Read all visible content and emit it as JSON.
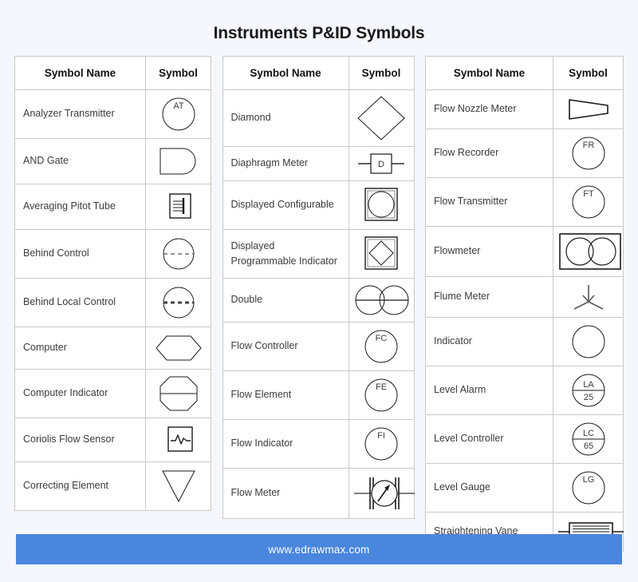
{
  "title": "Instruments P&ID Symbols",
  "colors": {
    "page_background": "#f5f7fd",
    "table_background": "#ffffff",
    "border": "#c9c9c9",
    "stroke": "#1a1a1a",
    "footer_background": "#4a86dd",
    "footer_text": "#ffffff"
  },
  "headers": {
    "name": "Symbol Name",
    "symbol": "Symbol"
  },
  "tables": [
    {
      "id": "table-1",
      "rows": [
        {
          "name": "Analyzer Transmitter",
          "symbol": "circle-labeled",
          "label": "AT"
        },
        {
          "name": "AND Gate",
          "symbol": "and-gate"
        },
        {
          "name": "Averaging Pitot Tube",
          "symbol": "pitot-tube"
        },
        {
          "name": "Behind Control",
          "symbol": "circle-dashed-thin"
        },
        {
          "name": "Behind Local Control",
          "symbol": "circle-dashed-thick"
        },
        {
          "name": "Computer",
          "symbol": "hexagon"
        },
        {
          "name": "Computer Indicator",
          "symbol": "octagon-divided"
        },
        {
          "name": "Coriolis Flow Sensor",
          "symbol": "coriolis-wave-box"
        },
        {
          "name": "Correcting Element",
          "symbol": "triangle-down"
        }
      ]
    },
    {
      "id": "table-2",
      "rows": [
        {
          "name": "Diamond",
          "symbol": "diamond"
        },
        {
          "name": "Diaphragm Meter",
          "symbol": "inline-box-labeled",
          "label": "D"
        },
        {
          "name": "Displayed Configurable",
          "symbol": "double-square-circle"
        },
        {
          "name": "Displayed Programmable Indicator",
          "symbol": "double-square-diamond"
        },
        {
          "name": "Double",
          "symbol": "double-circle"
        },
        {
          "name": "Flow Controller",
          "symbol": "circle-labeled",
          "label": "FC"
        },
        {
          "name": "Flow Element",
          "symbol": "circle-labeled",
          "label": "FE"
        },
        {
          "name": "Flow Indicator",
          "symbol": "circle-labeled",
          "label": "FI"
        },
        {
          "name": "Flow Meter",
          "symbol": "flow-meter-gauge"
        }
      ]
    },
    {
      "id": "table-3",
      "rows": [
        {
          "name": "Flow Nozzle Meter",
          "symbol": "flow-nozzle"
        },
        {
          "name": "Flow Recorder",
          "symbol": "circle-labeled",
          "label": "FR"
        },
        {
          "name": "Flow Transmitter",
          "symbol": "circle-labeled",
          "label": "FT"
        },
        {
          "name": "Flowmeter",
          "symbol": "box-two-circles"
        },
        {
          "name": "Flume Meter",
          "symbol": "flume-meter"
        },
        {
          "name": "Indicator",
          "symbol": "circle-plain"
        },
        {
          "name": "Level Alarm",
          "symbol": "circle-split-labeled",
          "label": "LA",
          "label2": "25"
        },
        {
          "name": "Level Controller",
          "symbol": "circle-split-labeled",
          "label": "LC",
          "label2": "65"
        },
        {
          "name": "Level Gauge",
          "symbol": "circle-labeled",
          "label": "LG"
        },
        {
          "name": "Straightening Vane",
          "symbol": "straightening-vane"
        }
      ]
    }
  ],
  "footer": {
    "url": "www.edrawmax.com"
  }
}
